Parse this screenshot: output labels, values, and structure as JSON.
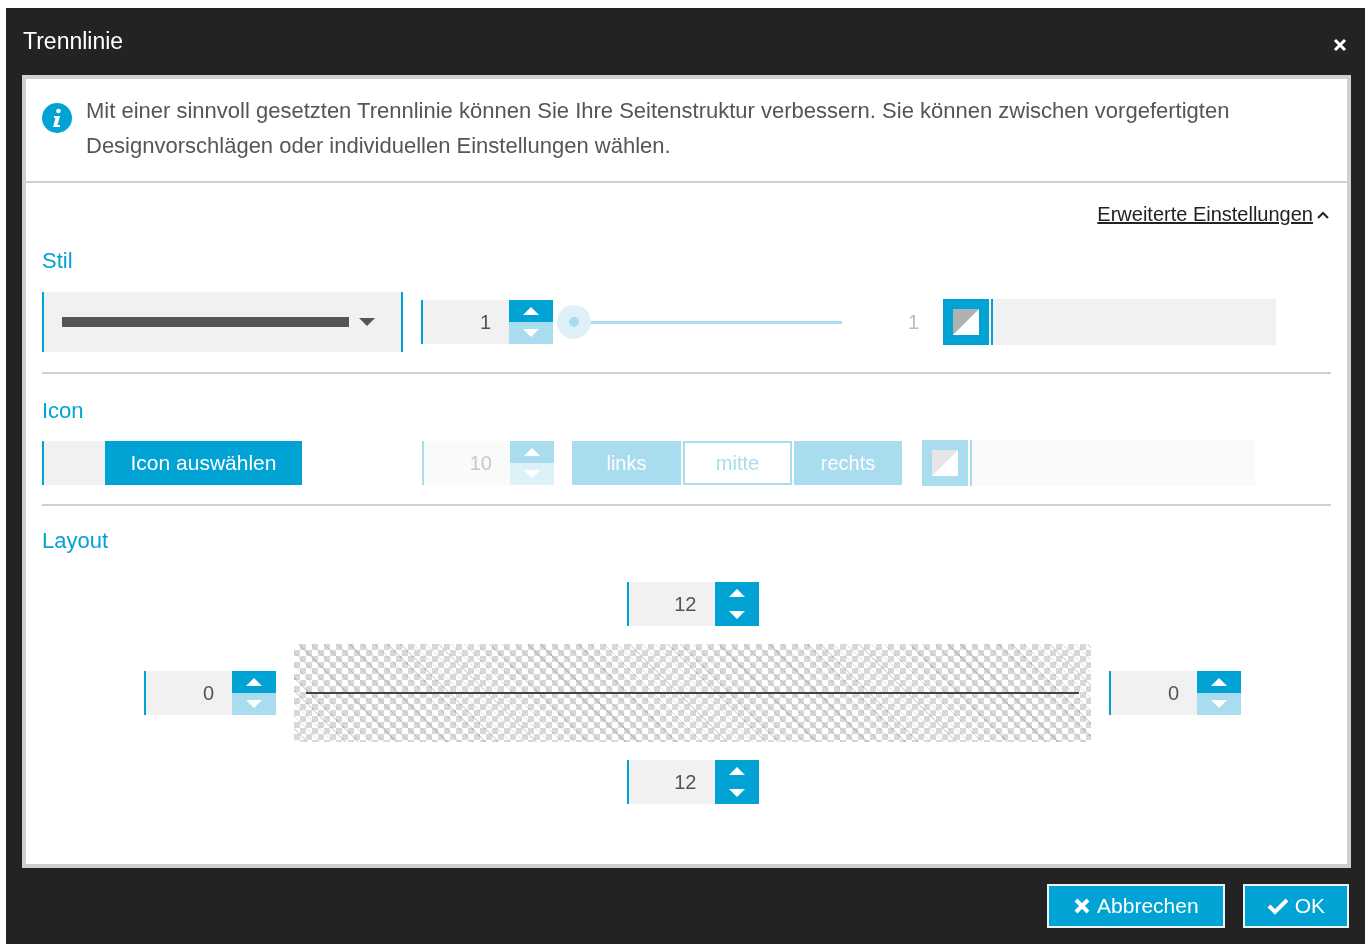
{
  "dialog": {
    "title": "Trennlinie"
  },
  "info": {
    "text": "Mit einer sinnvoll gesetzten Trennlinie können Sie Ihre Seitenstruktur verbessern. Sie können zwischen vorgefertigten Designvorschlägen oder individuellen Einstellungen wählen."
  },
  "advanced_link": {
    "label": "Erweiterte Einstellungen",
    "expanded": true
  },
  "style_section": {
    "heading": "Stil",
    "line_select": {
      "expanded": false
    },
    "width_stepper": {
      "value": "1",
      "disabled": false,
      "at_minimum": true
    },
    "width_slider": {
      "level": 0,
      "reading": "1",
      "disabled": false
    },
    "color_picker": {
      "disabled": false
    }
  },
  "icon_section": {
    "heading": "Icon",
    "choose_button": "Icon auswählen",
    "size_stepper": {
      "value": "10",
      "disabled": true,
      "at_minimum": true
    },
    "alignment_disabled": true,
    "alignment": [
      {
        "label": "links",
        "selected": false
      },
      {
        "label": "mitte",
        "selected": true
      },
      {
        "label": "rechts",
        "selected": false
      }
    ],
    "color_picker": {
      "disabled": true
    }
  },
  "layout_section": {
    "heading": "Layout",
    "top": {
      "value": "12",
      "disabled": false,
      "at_minimum": false
    },
    "left": {
      "value": "0",
      "disabled": false,
      "at_minimum": true
    },
    "right": {
      "value": "0",
      "disabled": false,
      "at_minimum": true
    },
    "bottom": {
      "value": "12",
      "disabled": false,
      "at_minimum": false
    }
  },
  "buttons": [
    {
      "label": "Abbrechen",
      "kind": "cancel"
    },
    {
      "label": "OK",
      "kind": "ok"
    }
  ]
}
